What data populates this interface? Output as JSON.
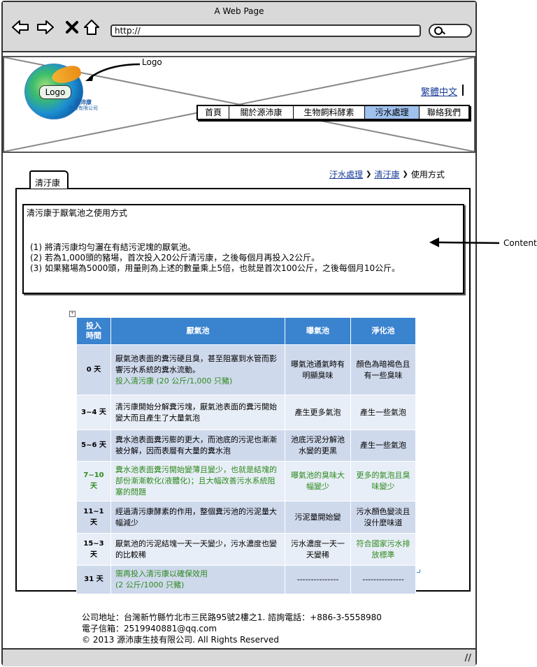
{
  "window": {
    "title": "A Web Page",
    "url": "http://"
  },
  "toolbar": {
    "back_icon": "back-arrow-icon",
    "forward_icon": "forward-arrow-icon",
    "close_icon": "close-icon",
    "home_icon": "home-icon"
  },
  "header": {
    "logo_text": "Logo",
    "logo_company_line1": "源沛康",
    "logo_company_line2": "生技有限公司",
    "logo_annotation": "Logo",
    "language_link": "繁體中文",
    "nav": [
      {
        "label": "首頁",
        "active": false
      },
      {
        "label": "關於源沛康",
        "active": false
      },
      {
        "label": "生物飼料酵素",
        "active": false
      },
      {
        "label": "污水處理",
        "active": true
      },
      {
        "label": "聯絡我們",
        "active": false
      }
    ]
  },
  "breadcrumb": {
    "item1": "汙水處理",
    "item2": "清汙康",
    "current": "使用方式",
    "separator": "❯"
  },
  "tab": {
    "label": "清汙康"
  },
  "content": {
    "title": "清污康于厭氧池之使用方式",
    "instructions": [
      "(1) 將清污康均勻灑在有結污泥塊的厭氧池。",
      "(2) 若為1,000頭的豬場，首次投入20公斤清污康，之後每個月再投入2公斤。",
      "(3) 如果豬場為5000頭，用量則為上述的數量乘上5倍，也就是首次100公斤，之後每個月10公斤。"
    ],
    "annotation": "Content"
  },
  "table": {
    "headers": [
      "投入\n時間",
      "厭氣池",
      "曝氣池",
      "淨化池"
    ],
    "rows": [
      {
        "day": "0 天",
        "anaerobic": "厭氣池表面的糞污硬且臭，甚至阻塞到水管而影響污水系統的糞水流動。",
        "anaerobic_note": "投入清污康 (20 公斤/1,000 只豬)",
        "aeration": "曝氣池通氣時有明顯臭味",
        "purify": "顏色為暗褐色且有一些臭味",
        "green": false
      },
      {
        "day": "3~4 天",
        "anaerobic": "清污康開始分解糞污塊，厭氣池表面的糞污開始變大而且產生了大量氣泡",
        "anaerobic_note": "",
        "aeration": "產生更多氣泡",
        "purify": "產生一些氣泡",
        "green": false
      },
      {
        "day": "5~6 天",
        "anaerobic": "糞水池表面糞污膨的更大，而池底的污泥也漸漸被分解，因而表層有大量的糞水泡",
        "anaerobic_note": "",
        "aeration": "池底污泥分解池水變的更黑",
        "purify": "產生一些氣泡",
        "green": false
      },
      {
        "day": "7~10 天",
        "anaerobic": "糞水池表面糞污開始變薄且變少，也就是結塊的部份漸漸軟化(液體化)；且大幅改善污水系統阻塞的問題",
        "anaerobic_note": "",
        "aeration": "曝氣池的臭味大幅變少",
        "purify": "更多的氣泡且臭味變少",
        "green": true
      },
      {
        "day": "11~1 天",
        "anaerobic": "經過清污康酵素的作用，整個糞污池的污泥量大幅減少",
        "anaerobic_note": "",
        "aeration": "污泥量開始變",
        "purify": "污水顏色變淡且沒什麼味道",
        "green": false
      },
      {
        "day": "15~3 天",
        "anaerobic": "厭氣池的污泥結塊一天一天變少，污水濃度也變的比較稀",
        "anaerobic_note": "",
        "aeration": "污水濃度一天一天變稀",
        "purify": "符合國家污水排放標準",
        "green": false,
        "purify_green": true
      },
      {
        "day": "31 天",
        "anaerobic": "需再投入清污康以確保效用",
        "anaerobic_note": "(2 公斤/1000 只豬)",
        "aeration": "---------------",
        "purify": "---------------",
        "green": false,
        "anaerobic_green": true
      }
    ]
  },
  "footer": {
    "address": "公司地址：台灣新竹縣竹北市三民路95號2樓之1. 諮詢電話：+886-3-5558980",
    "email": "電子信箱：2519940881@qq.com",
    "copyright": "© 2013 源沛康生技有限公司. All Rights Reserved"
  }
}
